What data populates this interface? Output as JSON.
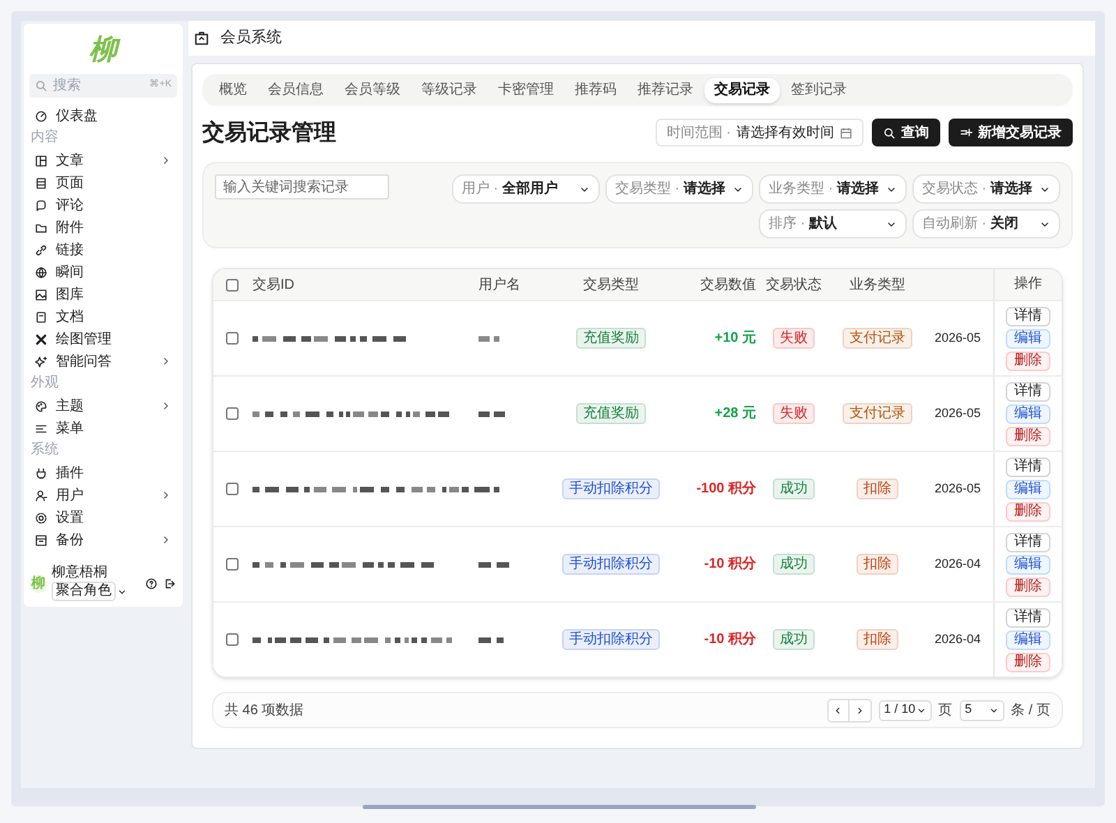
{
  "logo": {
    "text": "柳"
  },
  "sidebar": {
    "search": {
      "placeholder": "搜索",
      "shortcut": "⌘+K"
    },
    "items": [
      {
        "kind": "item",
        "label": "仪表盘",
        "expandable": false
      },
      {
        "kind": "section",
        "label": "内容"
      },
      {
        "kind": "item",
        "label": "文章",
        "expandable": true
      },
      {
        "kind": "item",
        "label": "页面",
        "expandable": false
      },
      {
        "kind": "item",
        "label": "评论",
        "expandable": false
      },
      {
        "kind": "item",
        "label": "附件",
        "expandable": false
      },
      {
        "kind": "item",
        "label": "链接",
        "expandable": false
      },
      {
        "kind": "item",
        "label": "瞬间",
        "expandable": false
      },
      {
        "kind": "item",
        "label": "图库",
        "expandable": false
      },
      {
        "kind": "item",
        "label": "文档",
        "expandable": false
      },
      {
        "kind": "item",
        "label": "绘图管理",
        "expandable": false
      },
      {
        "kind": "item",
        "label": "智能问答",
        "expandable": true
      },
      {
        "kind": "section",
        "label": "外观"
      },
      {
        "kind": "item",
        "label": "主题",
        "expandable": true
      },
      {
        "kind": "item",
        "label": "菜单",
        "expandable": false
      },
      {
        "kind": "section",
        "label": "系统"
      },
      {
        "kind": "item",
        "label": "插件",
        "expandable": false
      },
      {
        "kind": "item",
        "label": "用户",
        "expandable": true
      },
      {
        "kind": "item",
        "label": "设置",
        "expandable": false
      },
      {
        "kind": "item",
        "label": "备份",
        "expandable": true
      }
    ],
    "user": {
      "avatar": "柳",
      "name": "柳意梧桐",
      "role": "聚合角色"
    }
  },
  "header": {
    "title": "会员系统"
  },
  "tabs": [
    {
      "label": "概览",
      "selected": false
    },
    {
      "label": "会员信息",
      "selected": false
    },
    {
      "label": "会员等级",
      "selected": false
    },
    {
      "label": "等级记录",
      "selected": false
    },
    {
      "label": "卡密管理",
      "selected": false
    },
    {
      "label": "推荐码",
      "selected": false
    },
    {
      "label": "推荐记录",
      "selected": false
    },
    {
      "label": "交易记录",
      "selected": true
    },
    {
      "label": "签到记录",
      "selected": false
    }
  ],
  "page_title": "交易记录管理",
  "date_range": {
    "label": "时间范围 ·",
    "placeholder": "请选择有效时间"
  },
  "buttons": [
    {
      "kind": "search",
      "label": "查询"
    },
    {
      "kind": "add",
      "label": "新增交易记录"
    }
  ],
  "filters": {
    "search": {
      "placeholder": "输入关键词搜索记录"
    },
    "selects": [
      {
        "label": "用户 ·",
        "value": "全部用户"
      },
      {
        "label": "交易类型 ·",
        "value": "请选择"
      },
      {
        "label": "业务类型 ·",
        "value": "请选择"
      },
      {
        "label": "交易状态 ·",
        "value": "请选择"
      },
      {
        "label": "排序 ·",
        "value": "默认"
      },
      {
        "label": "自动刷新 ·",
        "value": "关闭"
      }
    ]
  },
  "table": {
    "all_selected": false,
    "columns": [
      "交易ID",
      "用户名",
      "交易类型",
      "交易数值",
      "交易状态",
      "业务类型",
      "操作"
    ],
    "rows": [
      {
        "selected": false,
        "type": {
          "text": "充值奖励",
          "color": "#15803d"
        },
        "value": {
          "text": "+10 元",
          "color": "#16a34a"
        },
        "status": {
          "text": "失败",
          "color": "#dc2626"
        },
        "business": {
          "text": "支付记录",
          "color": "#b45309"
        },
        "date": "2026-05",
        "actions": [
          "详情",
          "编辑",
          "删除"
        ]
      },
      {
        "selected": false,
        "type": {
          "text": "充值奖励",
          "color": "#15803d"
        },
        "value": {
          "text": "+28 元",
          "color": "#16a34a"
        },
        "status": {
          "text": "失败",
          "color": "#dc2626"
        },
        "business": {
          "text": "支付记录",
          "color": "#b45309"
        },
        "date": "2026-05",
        "actions": [
          "详情",
          "编辑",
          "删除"
        ]
      },
      {
        "selected": false,
        "type": {
          "text": "手动扣除积分",
          "color": "#1d4ed8"
        },
        "value": {
          "text": "-100 积分",
          "color": "#dc2626"
        },
        "status": {
          "text": "成功",
          "color": "#15803d"
        },
        "business": {
          "text": "扣除",
          "color": "#c2410c"
        },
        "date": "2026-05",
        "actions": [
          "详情",
          "编辑",
          "删除"
        ]
      },
      {
        "selected": false,
        "type": {
          "text": "手动扣除积分",
          "color": "#1d4ed8"
        },
        "value": {
          "text": "-10 积分",
          "color": "#dc2626"
        },
        "status": {
          "text": "成功",
          "color": "#15803d"
        },
        "business": {
          "text": "扣除",
          "color": "#c2410c"
        },
        "date": "2026-04",
        "actions": [
          "详情",
          "编辑",
          "删除"
        ]
      },
      {
        "selected": false,
        "type": {
          "text": "手动扣除积分",
          "color": "#1d4ed8"
        },
        "value": {
          "text": "-10 积分",
          "color": "#dc2626"
        },
        "status": {
          "text": "成功",
          "color": "#15803d"
        },
        "business": {
          "text": "扣除",
          "color": "#c2410c"
        },
        "date": "2026-04",
        "actions": [
          "详情",
          "编辑",
          "删除"
        ]
      }
    ]
  },
  "pagination": {
    "total": "共 46 项数据",
    "page": "1 / 10",
    "page_unit": "页",
    "page_size": "5",
    "size_unit": "条 / 页"
  }
}
